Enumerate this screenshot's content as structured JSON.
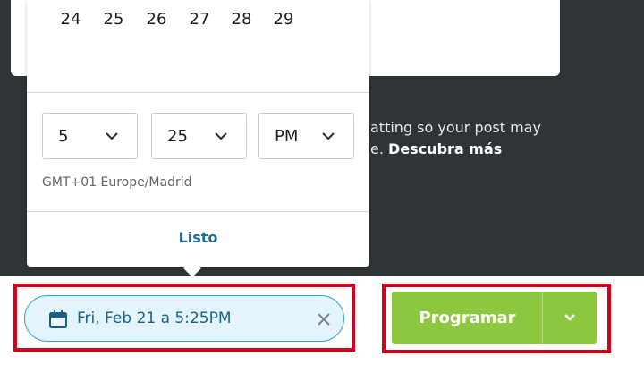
{
  "calendar": {
    "days": [
      "24",
      "25",
      "26",
      "27",
      "28",
      "29"
    ]
  },
  "time": {
    "hour": "5",
    "minute": "25",
    "period": "PM",
    "timezone": "GMT+01 Europe/Madrid"
  },
  "popover": {
    "done_label": "Listo"
  },
  "background": {
    "text_line1": "atting so your post may",
    "text_line2_prefix": "e.",
    "learn_more": "Descubra más"
  },
  "footer": {
    "scheduled_date": "Fri, Feb 21 a 5:25PM",
    "schedule_label": "Programar"
  },
  "colors": {
    "accent_green": "#8dc63f",
    "pill_blue": "#2fa1d8",
    "link_blue": "#1a6d9c",
    "highlight_red": "#d7001a"
  },
  "icons": {
    "calendar": "calendar-icon",
    "clear": "close-icon",
    "chevron": "chevron-down-icon"
  }
}
